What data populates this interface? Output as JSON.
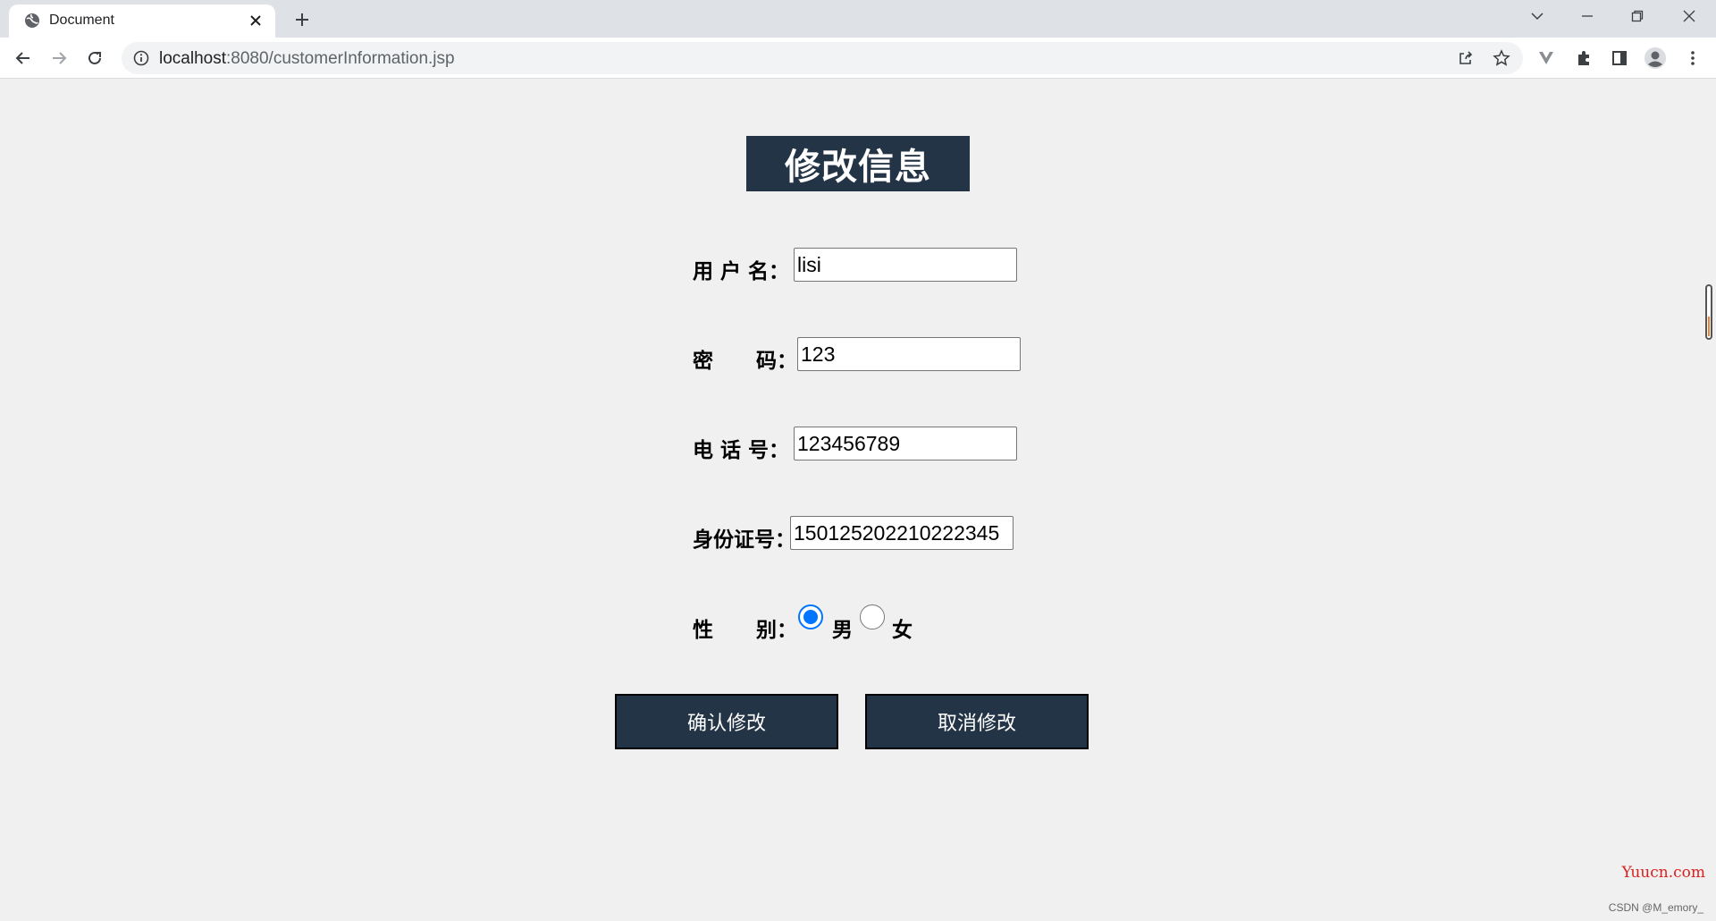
{
  "browser": {
    "tab_title": "Document",
    "url_host": "localhost",
    "url_rest": ":8080/customerInformation.jsp"
  },
  "icons": {
    "favicon": "globe-icon",
    "tab_close": "close-icon",
    "new_tab": "plus-icon",
    "tab_search": "chevron-down-icon",
    "minimize": "minimize-icon",
    "restore": "restore-icon",
    "close_window": "close-icon",
    "back": "back-arrow-icon",
    "forward": "forward-arrow-icon",
    "reload": "reload-icon",
    "site_info": "info-icon",
    "share": "share-icon",
    "bookmark": "star-icon",
    "extension_v": "v-extension-icon",
    "extensions": "puzzle-icon",
    "side_panel": "side-panel-icon",
    "profile": "profile-icon",
    "menu": "kebab-menu-icon"
  },
  "page": {
    "heading": "修改信息",
    "fields": {
      "username": {
        "label": "用 户 名：",
        "value": "lisi"
      },
      "password": {
        "label": "密      码：",
        "value": "123"
      },
      "phone": {
        "label": "电 话 号：",
        "value": "123456789"
      },
      "idcard": {
        "label": "身份证号：",
        "value": "150125202210222345"
      },
      "gender": {
        "label": "性      别：",
        "options": [
          "男",
          "女"
        ],
        "selected": "男"
      }
    },
    "buttons": {
      "confirm": "确认修改",
      "cancel": "取消修改"
    }
  },
  "watermark": {
    "site": "Yuucn.com",
    "credit": "CSDN @M_emory_"
  },
  "colors": {
    "accent_dark": "#243447",
    "radio_blue": "#0075ff",
    "page_bg": "#f0f0f0"
  }
}
